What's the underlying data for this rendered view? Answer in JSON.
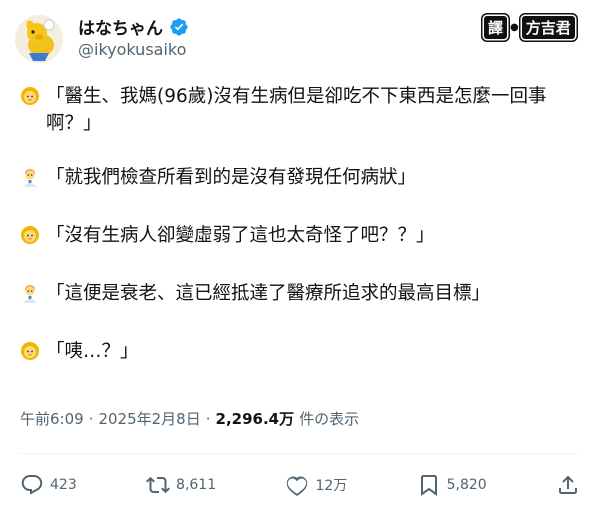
{
  "author": {
    "name": "はなちゃん",
    "handle": "@ikyokusaiko",
    "verified_badge_icon": "verified-badge-icon",
    "avatar_icon": "avatar-icon"
  },
  "translator_credit": {
    "tag": "譯",
    "name": "方吉君"
  },
  "tweet": {
    "lines": [
      {
        "speaker_icon": "woman-emoji-icon",
        "text": "「醫生、我媽(96歲)沒有生病但是卻吃不下東西是怎麼一回事啊？」"
      },
      {
        "speaker_icon": "man-doctor-emoji-icon",
        "text": "「就我們檢查所看到的是沒有發現任何病狀」"
      },
      {
        "speaker_icon": "woman-emoji-icon",
        "text": "「沒有生病人卻變虛弱了這也太奇怪了吧？？」"
      },
      {
        "speaker_icon": "man-doctor-emoji-icon",
        "text": "「這便是衰老、這已經抵達了醫療所追求的最高目標」"
      },
      {
        "speaker_icon": "woman-emoji-icon",
        "text": "「咦…？」"
      }
    ]
  },
  "meta": {
    "time": "午前6:09",
    "dot1": "·",
    "date": "2025年2月8日",
    "dot2": "·",
    "views": "2,296.4万",
    "views_label": "件の表示"
  },
  "actions": {
    "replies": "423",
    "reposts": "8,611",
    "likes": "12万",
    "bookmarks": "5,820",
    "icons": [
      "reply-icon",
      "repost-icon",
      "like-icon",
      "bookmark-icon",
      "share-icon"
    ]
  },
  "colors": {
    "text": "#0f1419",
    "secondary": "#536471",
    "verified": "#1d9bf0",
    "divider": "#eff3f4"
  }
}
